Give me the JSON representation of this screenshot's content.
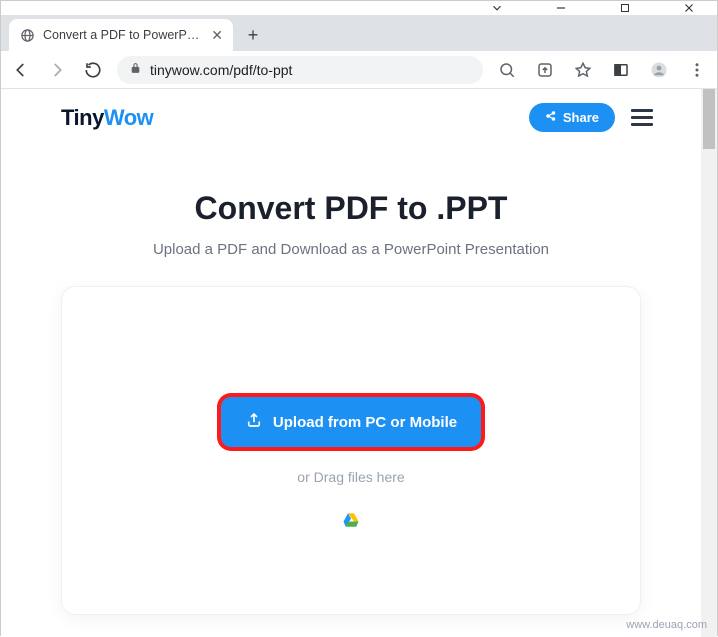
{
  "window": {
    "tab_title": "Convert a PDF to PowerPoint On",
    "url": "tinywow.com/pdf/to-ppt"
  },
  "site": {
    "logo_part1": "Tiny",
    "logo_part2": "Wow",
    "share_label": "Share"
  },
  "hero": {
    "title": "Convert PDF to .PPT",
    "subtitle": "Upload a PDF and Download as a PowerPoint Presentation"
  },
  "uploader": {
    "button_label": "Upload from PC or Mobile",
    "drag_label": "or Drag files here"
  },
  "watermark": "www.deuaq.com"
}
